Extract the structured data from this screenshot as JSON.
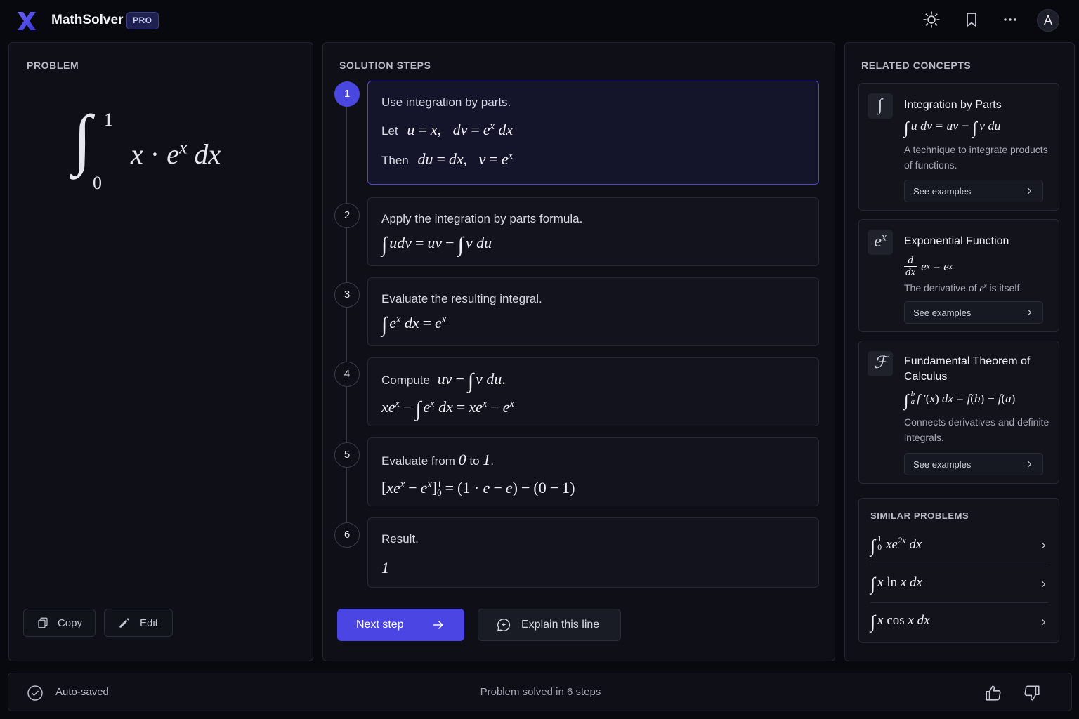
{
  "header": {
    "app_name": "MathSolver",
    "badge": "PRO",
    "avatar_initial": "A",
    "icons": [
      "logo-icon",
      "sun-icon",
      "bookmark-icon",
      "more-icon"
    ]
  },
  "problem": {
    "title": "PROBLEM",
    "integral": {
      "upper": "1",
      "lower": "0",
      "body": "x · e^x dx"
    },
    "copy_label": "Copy",
    "edit_label": "Edit"
  },
  "solution": {
    "title": "SOLUTION STEPS",
    "steps": [
      {
        "number": "1",
        "text": "Use integration by parts.",
        "let_label": "Let",
        "then_label": "Then"
      },
      {
        "number": "2",
        "text": "Apply the integration by parts formula."
      },
      {
        "number": "3",
        "text": "Evaluate the resulting integral."
      },
      {
        "number": "4",
        "text": "Compute"
      },
      {
        "number": "5",
        "text_a": "Evaluate from",
        "text_b": "to"
      },
      {
        "number": "6",
        "text": "Result.",
        "result": "1"
      }
    ],
    "next_label": "Next step",
    "explain_label": "Explain this line"
  },
  "related": {
    "title": "RELATED CONCEPTS",
    "concepts": [
      {
        "icon": "∫",
        "title": "Integration by Parts",
        "desc": "A technique to integrate products of functions.",
        "button": "See examples"
      },
      {
        "icon": "e^x",
        "title": "Exponential Function",
        "desc_a": "The derivative of",
        "desc_b": "is itself.",
        "button": "See examples"
      },
      {
        "icon": "ℱ",
        "title": "Fundamental Theorem of Calculus",
        "desc": "Connects derivatives and definite integrals.",
        "button": "See examples"
      }
    ]
  },
  "similar": {
    "title": "SIMILAR PROBLEMS"
  },
  "footer": {
    "status": "Auto-saved",
    "summary": "Problem solved in 6 steps",
    "icons": [
      "check-circle-icon",
      "thumbs-up-icon",
      "thumbs-down-icon"
    ]
  }
}
